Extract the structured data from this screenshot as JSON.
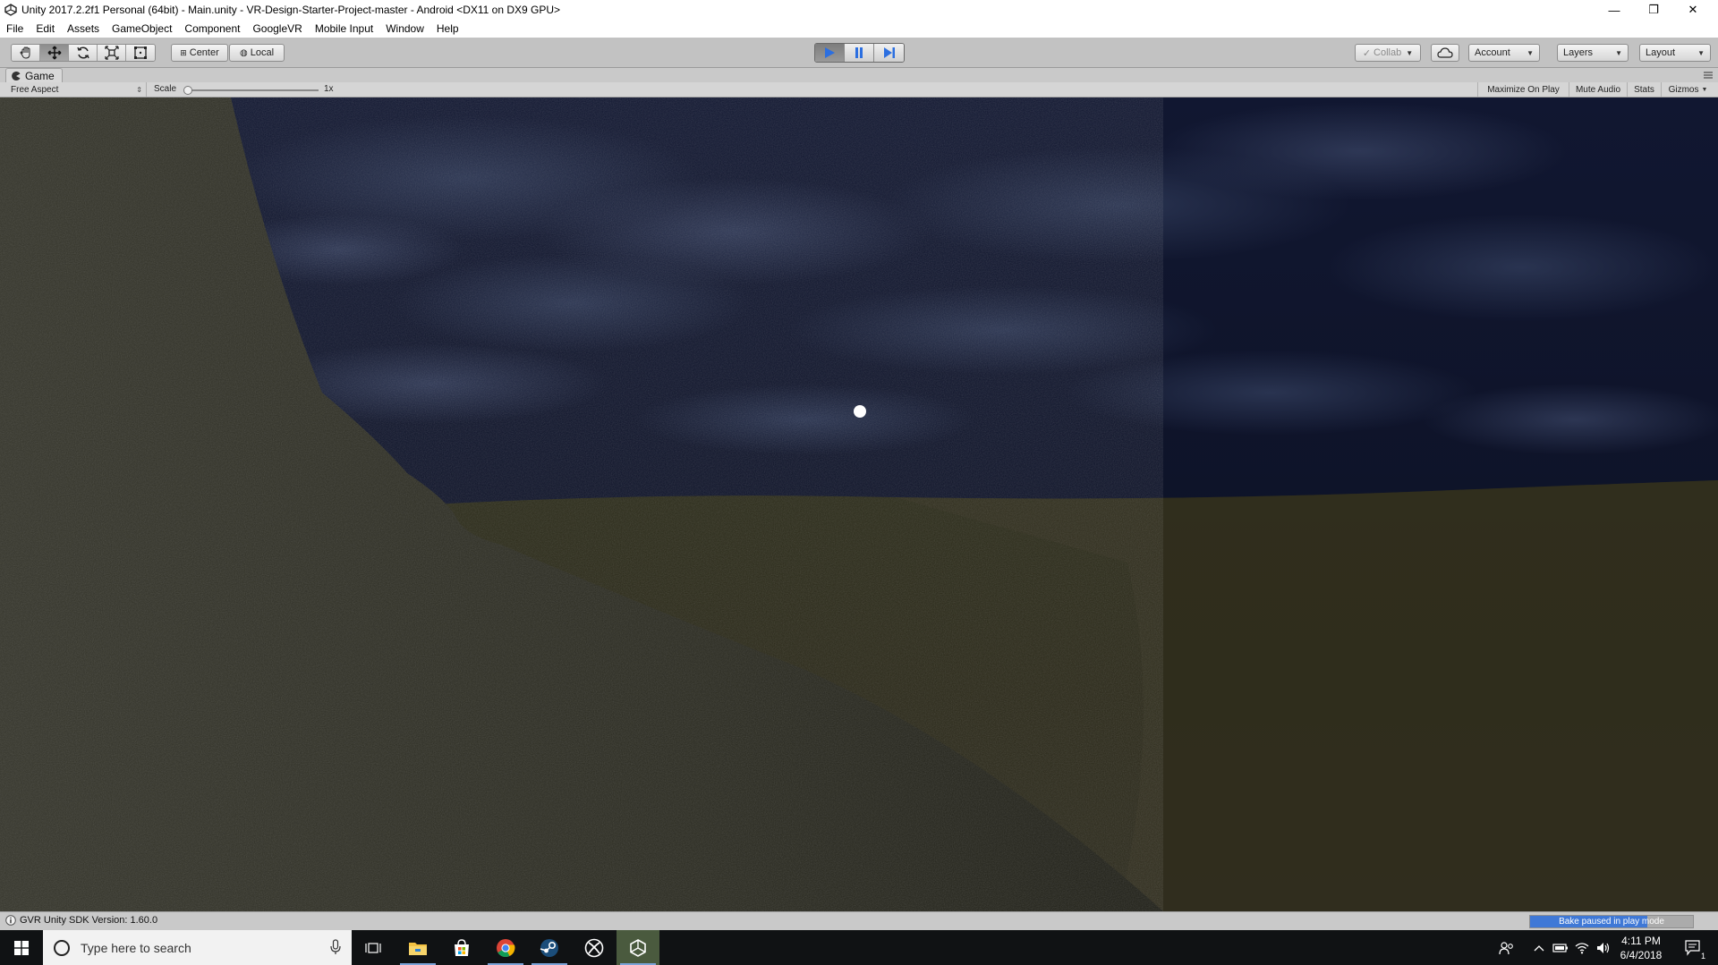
{
  "window": {
    "title": "Unity 2017.2.2f1 Personal (64bit) - Main.unity - VR-Design-Starter-Project-master - Android <DX11 on DX9 GPU>",
    "controls": {
      "minimize": "—",
      "restore": "❐",
      "close": "✕"
    }
  },
  "menu": [
    "File",
    "Edit",
    "Assets",
    "GameObject",
    "Component",
    "GoogleVR",
    "Mobile Input",
    "Window",
    "Help"
  ],
  "toolbar": {
    "tools": [
      "hand-icon",
      "move-icon",
      "rotate-icon",
      "scale-icon",
      "rect-tool-icon"
    ],
    "selected_tool": "move-icon",
    "pivot_label": "Center",
    "space_label": "Local",
    "playing": true,
    "collab_label": "Collab",
    "account_label": "Account",
    "layers_label": "Layers",
    "layout_label": "Layout"
  },
  "game_view": {
    "tab_label": "Game",
    "aspect_label": "Free Aspect",
    "scale_label": "Scale",
    "scale_value": "1x",
    "toggles": {
      "maximize": "Maximize On Play",
      "mute": "Mute Audio",
      "stats": "Stats",
      "gizmos": "Gizmos"
    }
  },
  "status": {
    "message": "GVR Unity SDK Version: 1.60.0",
    "bake_label": "Bake paused in play mode",
    "bake_progress": 0.72
  },
  "taskbar": {
    "search_placeholder": "Type here to search",
    "apps": [
      "task-view-icon",
      "file-explorer-icon",
      "store-icon",
      "chrome-icon",
      "steam-icon",
      "xbox-icon",
      "unity-icon"
    ],
    "time": "4:11 PM",
    "date": "6/4/2018",
    "notification_count": "1"
  },
  "colors": {
    "sky": "#0d1226",
    "ground": "#2c2c1a",
    "play_blue": "#2c6fe0",
    "bake_blue": "#3f78d6"
  }
}
